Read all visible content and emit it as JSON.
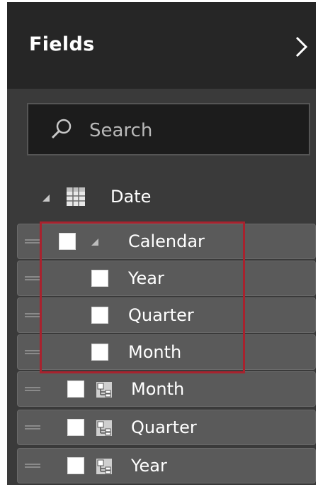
{
  "header": {
    "title": "Fields"
  },
  "search": {
    "placeholder": "Search"
  },
  "table": {
    "label": "Date"
  },
  "fields": [
    {
      "label": "Calendar",
      "kind": "hierarchy"
    },
    {
      "label": "Year",
      "kind": "hierarchy-level"
    },
    {
      "label": "Quarter",
      "kind": "hierarchy-level"
    },
    {
      "label": "Month",
      "kind": "hierarchy-level"
    },
    {
      "label": "Month",
      "kind": "column"
    },
    {
      "label": "Quarter",
      "kind": "column"
    },
    {
      "label": "Year",
      "kind": "column"
    }
  ],
  "colors": {
    "panel_background": "#3a3a3a",
    "header_background": "#262626",
    "row_background": "#5a5a5a",
    "highlight_border": "#a8222e",
    "text": "#ffffff"
  },
  "icons": {
    "collapse": "chevron-right-icon",
    "search": "search-icon",
    "table": "table-icon",
    "hierarchy": "hierarchy-icon",
    "column": "column-field-icon"
  }
}
